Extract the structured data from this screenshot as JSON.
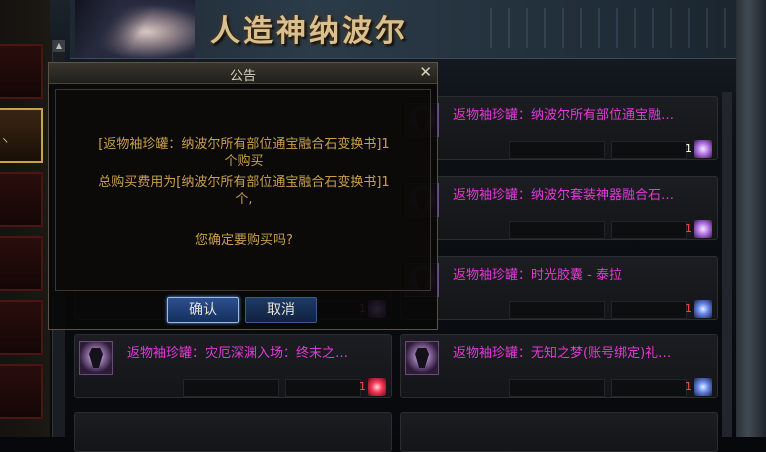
{
  "banner": {
    "title": "人造神纳波尔"
  },
  "left_menu": {
    "partial_label": "ヽ"
  },
  "items": [
    {
      "name": "返物袖珍罐：纳波尔所有部位通宝融…",
      "qty": "1",
      "icon": "purple-orb-icon",
      "qty_color": "#ffffff"
    },
    {
      "name": "返物袖珍罐：纳波尔套装神器融合石…",
      "qty": "1",
      "icon": "purple-crystal-icon",
      "qty_color": "#ff4a4a"
    },
    {
      "name": "返物袖珍罐：时光胶囊 - 泰拉",
      "qty": "1",
      "icon": "blue-crystal-icon",
      "qty_color": "#ff4a4a"
    },
    {
      "name": "返物袖珍罐：灾厄深渊入场：终末之…",
      "qty": "1",
      "icon": "red-orb-icon",
      "qty_color": "#ff4a4a"
    },
    {
      "name": "返物袖珍罐：无知之梦(账号绑定)礼…",
      "qty": "1",
      "icon": "blue-orb-icon",
      "qty_color": "#ff4a4a"
    }
  ],
  "hidden_item": {
    "qty": "1"
  },
  "dialog": {
    "title": "公告",
    "close": "✕",
    "line1": "[返物袖珍罐：纳波尔所有部位通宝融合石变换书]1",
    "line2": "个购买",
    "line3": "总购买费用为[纳波尔所有部位通宝融合石变换书]1",
    "line4": "个,",
    "question": "您确定要购买吗?",
    "confirm": "确认",
    "cancel": "取消"
  },
  "colors": {
    "item_name": "#e23ad8",
    "dialog_text": "#c9a04a",
    "banner_title": "#d9c08e"
  }
}
